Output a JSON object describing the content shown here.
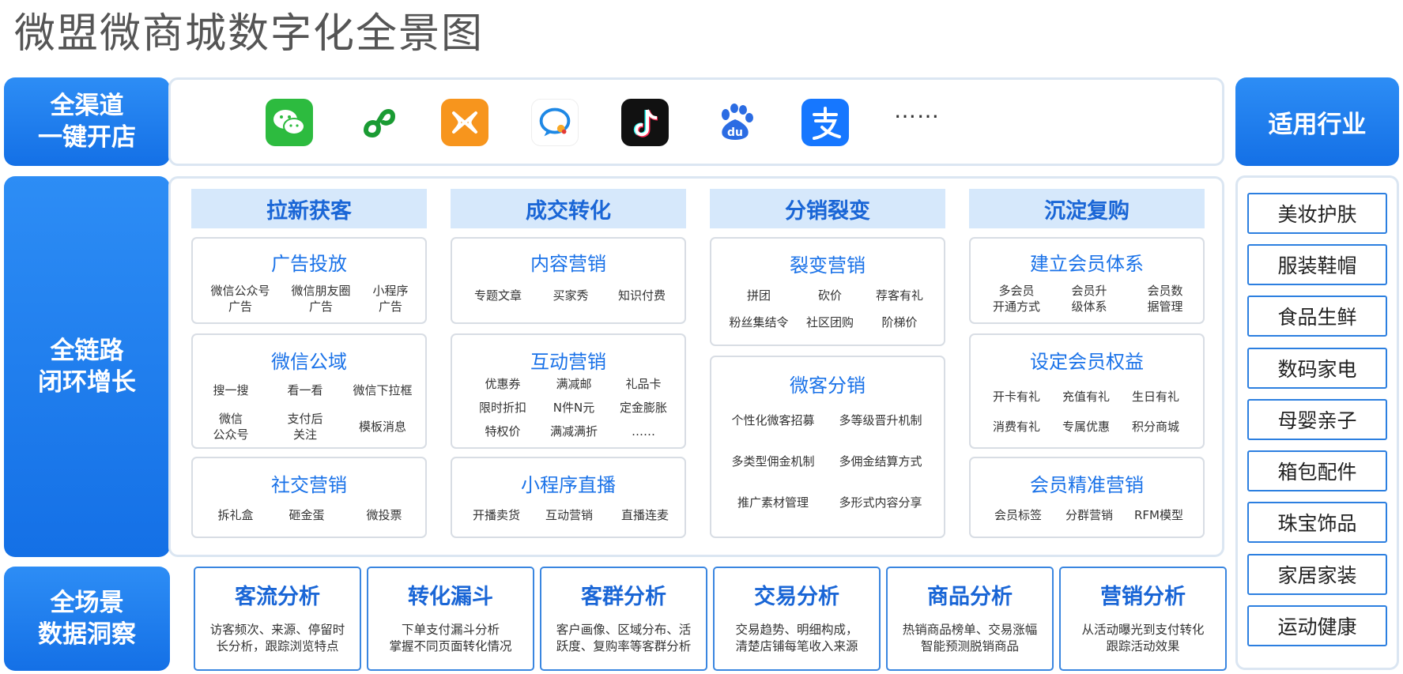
{
  "title": "微盟微商城数字化全景图",
  "sections": {
    "channels": {
      "line1": "全渠道",
      "line2": "一键开店"
    },
    "growth": {
      "line1": "全链路",
      "line2": "闭环增长"
    },
    "insight": {
      "line1": "全场景",
      "line2": "数据洞察"
    }
  },
  "channel_icons": [
    "wechat-icon",
    "mini-program-icon",
    "weimob-icon",
    "qq-chat-icon",
    "douyin-icon",
    "baidu-icon",
    "alipay-icon"
  ],
  "channel_more": "……",
  "columns": [
    {
      "header": "拉新获客",
      "cards": [
        {
          "title": "广告投放",
          "items": [
            "微信公众号\n广告",
            "微信朋友圈\n广告",
            "小程序\n广告"
          ]
        },
        {
          "title": "微信公域",
          "items": [
            "搜一搜",
            "看一看",
            "微信下拉框",
            "微信\n公众号",
            "支付后\n关注",
            "模板消息"
          ]
        },
        {
          "title": "社交营销",
          "items": [
            "拆礼盒",
            "砸金蛋",
            "微投票"
          ]
        }
      ]
    },
    {
      "header": "成交转化",
      "cards": [
        {
          "title": "内容营销",
          "items": [
            "专题文章",
            "买家秀",
            "知识付费"
          ]
        },
        {
          "title": "互动营销",
          "items": [
            "优惠券",
            "满减邮",
            "礼品卡",
            "限时折扣",
            "N件N元",
            "定金膨胀",
            "特权价",
            "满减满折",
            "……"
          ]
        },
        {
          "title": "小程序直播",
          "items": [
            "开播卖货",
            "互动营销",
            "直播连麦"
          ]
        }
      ]
    },
    {
      "header": "分销裂变",
      "cards": [
        {
          "title": "裂变营销",
          "items": [
            "拼团",
            "砍价",
            "荐客有礼",
            "粉丝集结令",
            "社区团购",
            "阶梯价"
          ]
        },
        {
          "title": "微客分销",
          "items": [
            "个性化微客招募",
            "多等级晋升机制",
            "多类型佣金机制",
            "多佣金结算方式",
            "推广素材管理",
            "多形式内容分享"
          ]
        }
      ]
    },
    {
      "header": "沉淀复购",
      "cards": [
        {
          "title": "建立会员体系",
          "items": [
            "多会员\n开通方式",
            "会员升\n级体系",
            "会员数\n据管理"
          ]
        },
        {
          "title": "设定会员权益",
          "items": [
            "开卡有礼",
            "充值有礼",
            "生日有礼",
            "消费有礼",
            "专属优惠",
            "积分商城"
          ]
        },
        {
          "title": "会员精准营销",
          "items": [
            "会员标签",
            "分群营销",
            "RFM模型"
          ]
        }
      ]
    }
  ],
  "analytics": [
    {
      "title": "客流分析",
      "desc": "访客频次、来源、停留时\n长分析，跟踪浏览特点"
    },
    {
      "title": "转化漏斗",
      "desc": "下单支付漏斗分析\n掌握不同页面转化情况"
    },
    {
      "title": "客群分析",
      "desc": "客户画像、区域分布、活\n跃度、复购率等客群分析"
    },
    {
      "title": "交易分析",
      "desc": "交易趋势、明细构成，\n清楚店铺每笔收入来源"
    },
    {
      "title": "商品分析",
      "desc": "热销商品榜单、交易涨幅\n智能预测脱销商品"
    },
    {
      "title": "营销分析",
      "desc": "从活动曝光到支付转化\n跟踪活动效果"
    }
  ],
  "industries": {
    "header": "适用行业",
    "items": [
      "美妆护肤",
      "服装鞋帽",
      "食品生鲜",
      "数码家电",
      "母婴亲子",
      "箱包配件",
      "珠宝饰品",
      "家居家装",
      "运动健康"
    ]
  },
  "colors": {
    "brand_blue": "#1a72e8",
    "header_bg": "#d6e8fb",
    "frame": "#dbe6f2"
  }
}
